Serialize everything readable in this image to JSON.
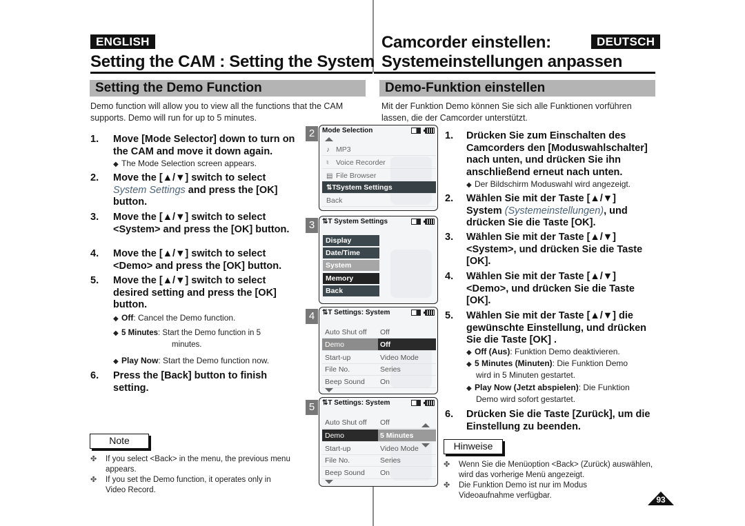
{
  "header": {
    "english_badge": "ENGLISH",
    "deutsch_badge": "DEUTSCH",
    "title_en": "Setting the CAM : Setting the System",
    "title_de_line1": "Camcorder einstellen:",
    "title_de_line2": "Systemeinstellungen anpassen"
  },
  "english": {
    "section_title": "Setting the Demo Function",
    "intro": "Demo function will allow you to view all the functions that the CAM supports. Demo will run for up to 5 minutes.",
    "steps": [
      {
        "num": "1.",
        "text": "Move [Mode Selector] down to turn on the CAM and move it down again."
      },
      {
        "num": "2.",
        "text_before": "Move the [▲/▼] switch to select ",
        "em": "System Settings",
        "text_after": " and press the [OK] button."
      },
      {
        "num": "3.",
        "text": "Move the [▲/▼] switch to select <System> and press the [OK] button."
      },
      {
        "num": "4.",
        "text": "Move the [▲/▼] switch to select <Demo> and press the [OK] button."
      },
      {
        "num": "5.",
        "text": "Move the [▲/▼] switch to select desired setting and press the [OK] button."
      },
      {
        "num": "6.",
        "text": "Press the [Back] button to finish setting."
      }
    ],
    "step1_bullet": "The Mode Selection screen appears.",
    "step5_bullets": [
      {
        "term": "Off",
        "desc": ": Cancel the Demo function."
      },
      {
        "term": "5 Minutes",
        "desc": ":  Start the Demo function in 5",
        "desc2": "minutes."
      },
      {
        "term": "Play Now",
        "desc": ": Start the Demo function now."
      }
    ],
    "note_label": "Note",
    "notes": [
      "If you select <Back> in the menu, the previous menu appears.",
      "If you set the Demo function, it operates only in Video Record."
    ]
  },
  "deutsch": {
    "section_title": "Demo-Funktion einstellen",
    "intro": "Mit der Funktion Demo können Sie sich alle Funktionen vorführen lassen, die der Camcorder unterstützt.",
    "steps": [
      {
        "num": "1.",
        "text": "Drücken Sie zum Einschalten des Camcorders den [Moduswahlschalter] nach unten, und drücken Sie ihn anschließend erneut nach unten."
      },
      {
        "num": "2.",
        "text_before": "Wählen Sie mit der Taste [▲/▼] System ",
        "em": "(Systemeinstellungen)",
        "text_after": ", und drücken Sie die Taste [OK]."
      },
      {
        "num": "3.",
        "text": "Wählen Sie mit der Taste [▲/▼] <System>, und drücken Sie die Taste [OK]."
      },
      {
        "num": "4.",
        "text": "Wählen Sie mit der Taste [▲/▼] <Demo>, und drücken Sie die Taste [OK]."
      },
      {
        "num": "5.",
        "text": "Wählen Sie mit der Taste [▲/▼] die gewünschte Einstellung, und drücken Sie die Taste [OK] ."
      },
      {
        "num": "6.",
        "text": "Drücken Sie die Taste [Zurück], um die Einstellung zu beenden."
      }
    ],
    "step1_bullet": "Der Bildschirm Moduswahl wird angezeigt.",
    "step5_bullets": [
      {
        "term": "Off (Aus)",
        "desc": ": Funktion Demo deaktivieren."
      },
      {
        "term": "5 Minutes (Minuten)",
        "desc": ": Die Funktion Demo",
        "desc2": "wird in 5 Minuten gestartet."
      },
      {
        "term": "Play Now (Jetzt abspielen)",
        "desc": ":  Die Funktion",
        "desc2": "Demo wird sofort gestartet."
      }
    ],
    "note_label": "Hinweise",
    "notes": [
      "Wenn Sie die Menüoption <Back> (Zurück) auswählen, wird das vorherige Menü angezeigt.",
      "Die Funktion Demo ist nur im Modus Videoaufnahme verfügbar."
    ]
  },
  "screens": {
    "s2": {
      "num": "2",
      "title": "Mode Selection",
      "items": [
        {
          "icon": "♪",
          "label": "MP3"
        },
        {
          "icon": "🎙",
          "label": "Voice Recorder"
        },
        {
          "icon": "▤",
          "label": "File Browser"
        },
        {
          "icon": "⇅T",
          "label": "System Settings",
          "selected": true
        },
        {
          "icon": "",
          "label": "Back"
        }
      ]
    },
    "s3": {
      "num": "3",
      "title": "System Settings",
      "items": [
        "Display",
        "Date/Time",
        "System",
        "Memory",
        "Back"
      ],
      "selected": "System"
    },
    "s4": {
      "num": "4",
      "title": "Settings: System",
      "rows": [
        {
          "key": "Auto Shut off",
          "value": "Off"
        },
        {
          "key": "Demo",
          "value": "Off"
        },
        {
          "key": "Start-up",
          "value": "Video Mode"
        },
        {
          "key": "File No.",
          "value": "Series"
        },
        {
          "key": "Beep Sound",
          "value": "On"
        }
      ]
    },
    "s5": {
      "num": "5",
      "title": "Settings: System",
      "rows": [
        {
          "key": "Auto Shut off",
          "value": "Off"
        },
        {
          "key": "Demo",
          "value": "5 Minutes"
        },
        {
          "key": "Start-up",
          "value": "Video Mode"
        },
        {
          "key": "File No.",
          "value": "Series"
        },
        {
          "key": "Beep Sound",
          "value": "On"
        }
      ]
    }
  },
  "page_number": "93",
  "colors": {
    "emphasis_text": "#4d6478",
    "section_bar": "#b4b4b4",
    "screen_selected": "#374045"
  }
}
